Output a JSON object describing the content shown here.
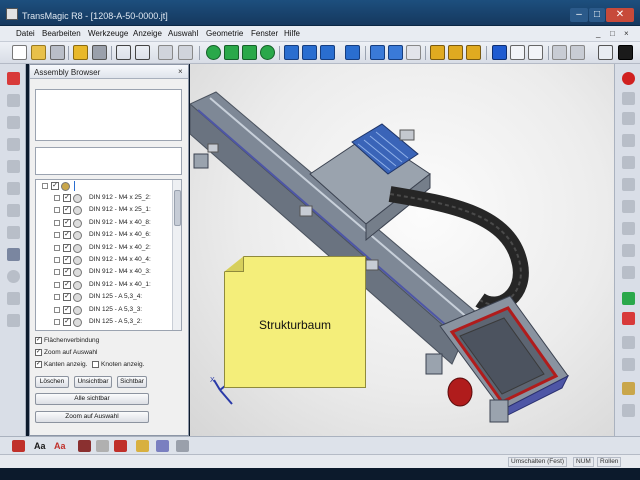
{
  "window": {
    "title": "TransMagic R8 - [1208-A-50-0000.jt]"
  },
  "menu": {
    "items": [
      "Datei",
      "Bearbeiten",
      "Werkzeuge",
      "Anzeige",
      "Auswahl",
      "Geometrie",
      "Fenster",
      "Hilfe"
    ],
    "mdi_controls": [
      "_",
      "□",
      "×"
    ]
  },
  "toolbar": {
    "icons": [
      "new-icon",
      "open-icon",
      "save-icon",
      "cut-icon",
      "print-icon",
      "select-arrow-icon",
      "select-box-icon",
      "measure-icon",
      "rotate-icon",
      "cube-front-icon",
      "cube-top-icon",
      "cube-side-icon",
      "cube-iso-icon",
      "cube-back-icon",
      "pan-icon",
      "orbit-icon",
      "zoom-in-icon",
      "zoom-window-icon",
      "zoom-fit-icon",
      "explode-icon",
      "assembly-icon",
      "shaded-cube-icon",
      "wire-cube-icon",
      "hidden-cube-icon",
      "grid-icon",
      "dark-screen-icon"
    ]
  },
  "browser": {
    "title": "Assembly Browser",
    "close_label": "×",
    "tree_items": [
      "DIN 912 - M4 x 25_2:",
      "DIN 912 - M4 x 25_1:",
      "DIN 912 - M4 x 40_8:",
      "DIN 912 - M4 x 40_6:",
      "DIN 912 - M4 x 40_2:",
      "DIN 912 - M4 x 40_4:",
      "DIN 912 - M4 x 40_3:",
      "DIN 912 - M4 x 40_1:",
      "DIN 125 - A 5,3_4:",
      "DIN 125 - A 5,3_3:",
      "DIN 125 - A 5,3_2:"
    ],
    "options": {
      "surface_connection": "Flächenverbindung",
      "zoom_to_selection": "Zoom auf Auswahl",
      "edges_show": "Kanten anzeig.",
      "nodes_show": "Knoten anzeig."
    },
    "buttons": {
      "delete": "Löschen",
      "invisible": "Unsichtbar",
      "visible": "Sichtbar",
      "all_visible": "Alle sichtbar",
      "zoom_to_selection": "Zoom auf Auswahl"
    }
  },
  "viewport": {
    "note_text": "Strukturbaum",
    "model_colors": {
      "rail": "#8e9aa8",
      "motor": "#3a64b8",
      "chain": "#2a2a2a",
      "red": "#b01c1c"
    }
  },
  "statusbar": {
    "cells": [
      "Umschalten (Fest)",
      "NUM",
      "Rollen"
    ]
  }
}
